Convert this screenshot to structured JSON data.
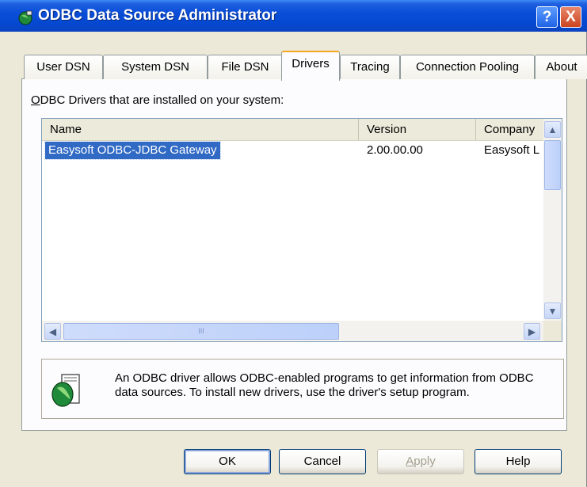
{
  "window": {
    "title": "ODBC Data Source Administrator",
    "help_glyph": "?",
    "close_glyph": "X"
  },
  "tabs": [
    {
      "label": "User DSN"
    },
    {
      "label": "System DSN"
    },
    {
      "label": "File DSN"
    },
    {
      "label": "Drivers",
      "active": true
    },
    {
      "label": "Tracing"
    },
    {
      "label": "Connection Pooling"
    },
    {
      "label": "About"
    }
  ],
  "drivers_panel": {
    "section_label_accel": "O",
    "section_label_rest": "DBC Drivers that are installed on your system:",
    "columns": [
      "Name",
      "Version",
      "Company"
    ],
    "rows": [
      {
        "name": "Easysoft ODBC-JDBC Gateway",
        "version": "2.00.00.00",
        "company": "Easysoft L",
        "selected": true
      }
    ],
    "scrollbar_glyph": "III"
  },
  "info": {
    "text": "An ODBC driver allows ODBC-enabled programs to get information from ODBC data sources.  To install new drivers, use the driver's setup program."
  },
  "buttons": {
    "ok": "OK",
    "cancel": "Cancel",
    "apply_accel": "A",
    "apply_rest": "pply",
    "help": "Help"
  },
  "colors": {
    "title_bar": "#0a4ed8",
    "selection": "#316ac5",
    "active_tab_accent": "#f5a623"
  }
}
